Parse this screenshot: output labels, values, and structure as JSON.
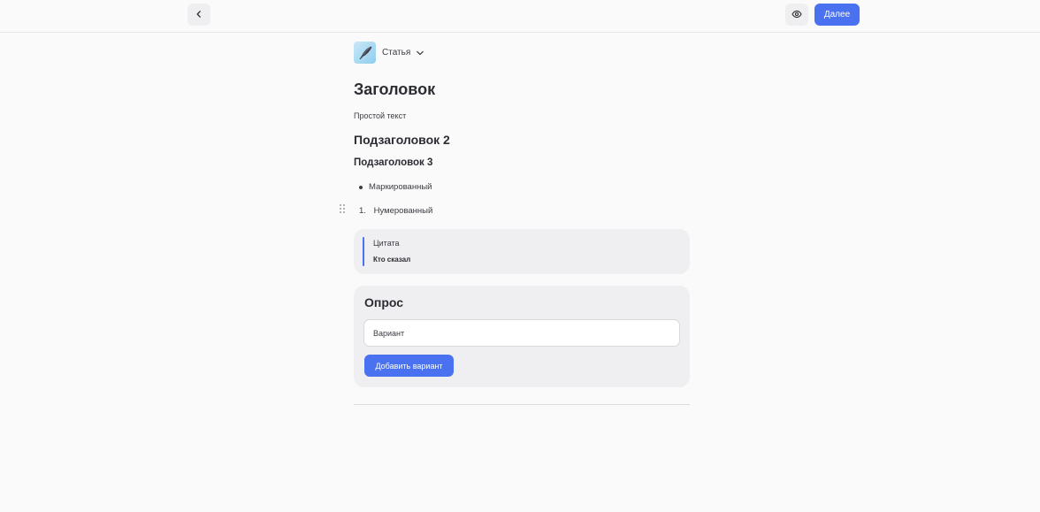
{
  "topbar": {
    "back_icon": "chevron-left-icon",
    "preview_icon": "eye-icon",
    "next_label": "Далее",
    "accent_color": "#4a72f0"
  },
  "editor": {
    "type_selector": {
      "icon": "quill-pen-icon",
      "label": "Статья",
      "chevron_icon": "chevron-down-icon"
    },
    "heading1": "Заголовок",
    "plain_text": "Простой текст",
    "heading2": "Подзаголовок 2",
    "heading3": "Подзаголовок 3",
    "bulleted_item": "Маркированный",
    "numbered_item": {
      "number": "1.",
      "text": "Нумерованный"
    },
    "drag_handle_icon": "drag-handle-icon",
    "quote": {
      "text": "Цитата",
      "author": "Кто сказал"
    },
    "poll": {
      "title": "Опрос",
      "option_placeholder": "Вариант",
      "add_option_label": "Добавить вариант"
    }
  }
}
